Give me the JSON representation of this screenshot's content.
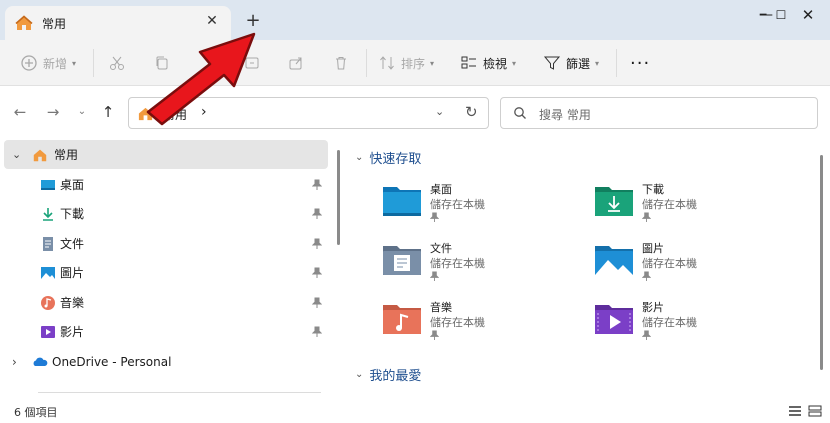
{
  "tab": {
    "title": "常用"
  },
  "toolbar": {
    "new_label": "新增",
    "sort_label": "排序",
    "view_label": "檢視",
    "filter_label": "篩選"
  },
  "address": {
    "crumb": "常用"
  },
  "search": {
    "placeholder": "搜尋 常用"
  },
  "sidebar": {
    "home_label": "常用",
    "items": [
      {
        "label": "桌面"
      },
      {
        "label": "下載"
      },
      {
        "label": "文件"
      },
      {
        "label": "圖片"
      },
      {
        "label": "音樂"
      },
      {
        "label": "影片"
      }
    ],
    "onedrive_label": "OneDrive - Personal"
  },
  "content": {
    "quick_access_heading": "快速存取",
    "favorites_heading": "我的最愛",
    "folders": [
      {
        "name": "桌面",
        "sub": "儲存在本機",
        "color": "#1f9bd8"
      },
      {
        "name": "下載",
        "sub": "儲存在本機",
        "color": "#1aa37a"
      },
      {
        "name": "文件",
        "sub": "儲存在本機",
        "color": "#7a8fa8"
      },
      {
        "name": "圖片",
        "sub": "儲存在本機",
        "color": "#1e8fd6"
      },
      {
        "name": "音樂",
        "sub": "儲存在本機",
        "color": "#e8735a"
      },
      {
        "name": "影片",
        "sub": "儲存在本機",
        "color": "#7b3fc7"
      }
    ]
  },
  "status": {
    "item_count": "6 個項目"
  },
  "colors": {
    "accent": "#1f4f8f",
    "arrow": "#e8161c",
    "titlebar": "#dde6f0"
  }
}
